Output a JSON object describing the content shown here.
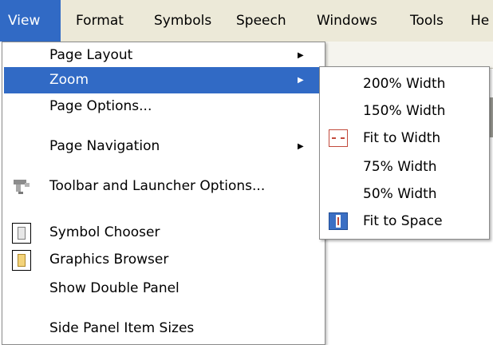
{
  "menubar": {
    "items": [
      {
        "label": "View",
        "active": true
      },
      {
        "label": "Format"
      },
      {
        "label": "Symbols"
      },
      {
        "label": "Speech"
      },
      {
        "label": "Windows"
      },
      {
        "label": "Tools"
      },
      {
        "label": "He"
      }
    ]
  },
  "view_menu": {
    "items": [
      {
        "label": "Page Layout",
        "submenu": true
      },
      {
        "label": "Zoom",
        "submenu": true,
        "highlighted": true
      },
      {
        "label": "Page Options..."
      },
      {
        "label": "Page Navigation",
        "submenu": true
      },
      {
        "label": "Toolbar and Launcher Options...",
        "icon": "toolbar-icon"
      },
      {
        "label": "Symbol Chooser",
        "icon": "symbol-chooser-icon"
      },
      {
        "label": "Graphics Browser",
        "icon": "graphics-browser-icon"
      },
      {
        "label": "Show Double Panel"
      },
      {
        "label": "Side Panel Item Sizes"
      }
    ],
    "submenu_arrow": "▶"
  },
  "zoom_menu": {
    "items": [
      {
        "label": "200% Width"
      },
      {
        "label": "150% Width"
      },
      {
        "label": "Fit to Width",
        "icon": "fit-to-width-icon"
      },
      {
        "label": "75% Width"
      },
      {
        "label": "50% Width"
      },
      {
        "label": "Fit to Space",
        "icon": "fit-to-space-icon"
      }
    ]
  },
  "colors": {
    "menubar_bg": "#ece9d8",
    "highlight": "#316ac5",
    "menu_bg": "#ffffff",
    "separator": "#a7a69d"
  }
}
